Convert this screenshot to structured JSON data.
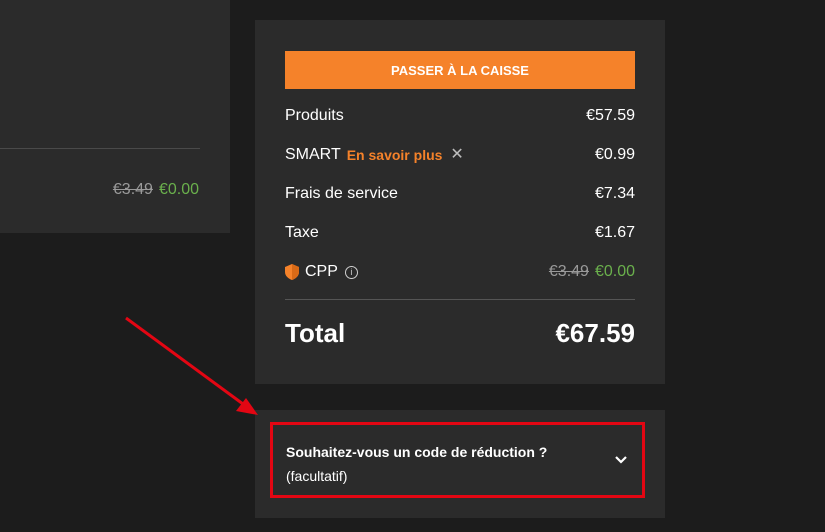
{
  "left_card": {
    "old_price": "€3.49",
    "new_price": "€0.00"
  },
  "summary": {
    "checkout_label": "PASSER À LA CAISSE",
    "rows": {
      "products": {
        "label": "Produits",
        "value": "€57.59"
      },
      "smart": {
        "label": "SMART",
        "link": "En savoir plus",
        "close": "✕",
        "value": "€0.99"
      },
      "service": {
        "label": "Frais de service",
        "value": "€7.34"
      },
      "tax": {
        "label": "Taxe",
        "value": "€1.67"
      },
      "cpp": {
        "label": "CPP",
        "info": "i",
        "old_value": "€3.49",
        "value": "€0.00"
      }
    },
    "total": {
      "label": "Total",
      "value": "€67.59"
    }
  },
  "promo": {
    "title": "Souhaitez-vous un code de réduction ?",
    "subtitle": "(facultatif)"
  },
  "colors": {
    "accent": "#f5822a",
    "free": "#6ab04c",
    "highlight": "#e30613",
    "background": "#1c1c1c",
    "card": "#2b2b2b"
  },
  "icons": {
    "close": "close-icon",
    "info": "info-icon",
    "shield": "shield-icon",
    "chevron": "chevron-down-icon",
    "arrow": "annotation-arrow"
  }
}
